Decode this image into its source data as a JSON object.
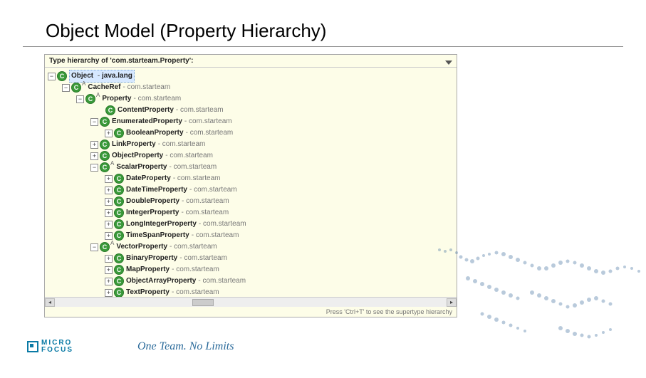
{
  "title": "Object Model (Property Hierarchy)",
  "panel": {
    "header": "Type hierarchy of 'com.starteam.Property':",
    "footer_hint": "Press 'Ctrl+T' to see the supertype hierarchy"
  },
  "tree": {
    "root": {
      "name": "Object",
      "pkg": "java.lang",
      "abstract": false,
      "selected": true
    },
    "cacheref": {
      "name": "CacheRef",
      "pkg": "com.starteam",
      "abstract": true
    },
    "property": {
      "name": "Property",
      "pkg": "com.starteam",
      "abstract": true
    },
    "content": {
      "name": "ContentProperty",
      "pkg": "com.starteam",
      "abstract": false
    },
    "enumerated": {
      "name": "EnumeratedProperty",
      "pkg": "com.starteam",
      "abstract": false
    },
    "boolean": {
      "name": "BooleanProperty",
      "pkg": "com.starteam",
      "abstract": false
    },
    "link": {
      "name": "LinkProperty",
      "pkg": "com.starteam",
      "abstract": false
    },
    "object": {
      "name": "ObjectProperty",
      "pkg": "com.starteam",
      "abstract": false
    },
    "scalar": {
      "name": "ScalarProperty",
      "pkg": "com.starteam",
      "abstract": true
    },
    "date": {
      "name": "DateProperty",
      "pkg": "com.starteam",
      "abstract": false
    },
    "datetime": {
      "name": "DateTimeProperty",
      "pkg": "com.starteam",
      "abstract": false
    },
    "double": {
      "name": "DoubleProperty",
      "pkg": "com.starteam",
      "abstract": false
    },
    "integer": {
      "name": "IntegerProperty",
      "pkg": "com.starteam",
      "abstract": false
    },
    "longint": {
      "name": "LongIntegerProperty",
      "pkg": "com.starteam",
      "abstract": false
    },
    "timespan": {
      "name": "TimeSpanProperty",
      "pkg": "com.starteam",
      "abstract": false
    },
    "vector": {
      "name": "VectorProperty",
      "pkg": "com.starteam",
      "abstract": true
    },
    "binary": {
      "name": "BinaryProperty",
      "pkg": "com.starteam",
      "abstract": false
    },
    "map": {
      "name": "MapProperty",
      "pkg": "com.starteam",
      "abstract": false
    },
    "objectarray": {
      "name": "ObjectArrayProperty",
      "pkg": "com.starteam",
      "abstract": false
    },
    "text": {
      "name": "TextProperty",
      "pkg": "com.starteam",
      "abstract": false
    }
  },
  "footer": {
    "logo_line1": "MICRO",
    "logo_line2": "FOCUS",
    "tagline": "One Team. No Limits"
  }
}
